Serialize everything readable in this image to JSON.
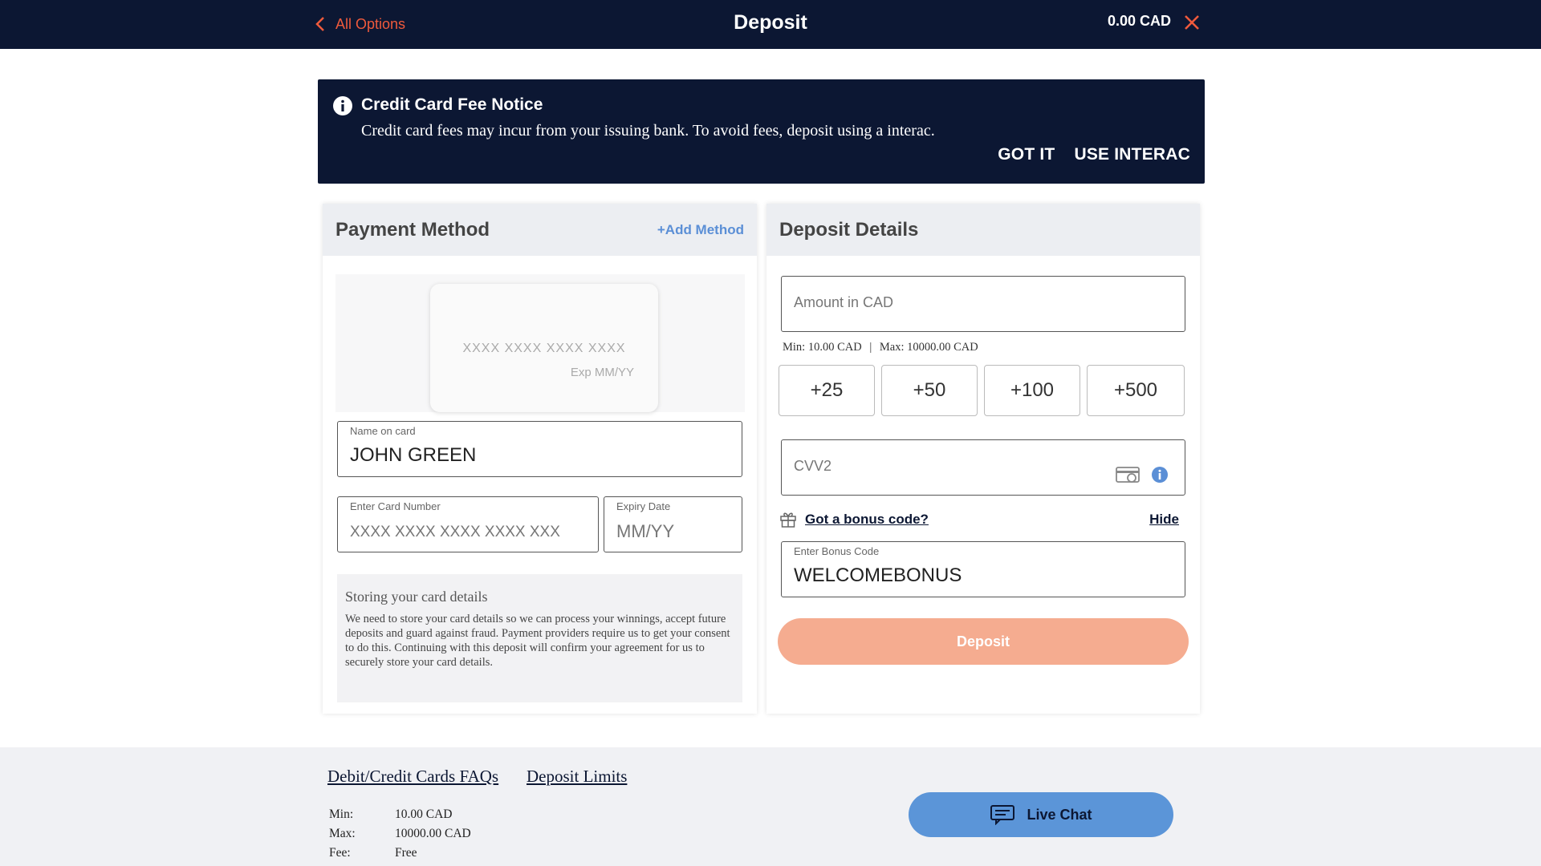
{
  "header": {
    "back_label": "All Options",
    "title": "Deposit",
    "balance": "0.00 CAD"
  },
  "notice": {
    "title": "Credit Card Fee Notice",
    "text": "Credit card fees may incur from your issuing bank. To avoid fees, deposit using a interac.",
    "got_it": "GOT IT",
    "use_interac": "USE INTERAC"
  },
  "payment_method": {
    "title": "Payment Method",
    "add_method": "+Add Method",
    "card_preview_number": "XXXX XXXX XXXX XXXX",
    "card_preview_exp": "Exp MM/YY",
    "name_label": "Name on card",
    "name_value": "JOHN GREEN",
    "card_number_label": "Enter Card Number",
    "card_number_placeholder": "XXXX XXXX XXXX XXXX XXX",
    "expiry_label": "Expiry Date",
    "expiry_placeholder": "MM/YY",
    "store_title": "Storing your card details",
    "store_text": "We need to store your card details so we can process your winnings, accept future deposits and guard against fraud. Payment providers require us to get your consent to do this. Continuing with this deposit will confirm your agreement for us to securely store your card details."
  },
  "deposit_details": {
    "title": "Deposit Details",
    "amount_placeholder": "Amount in CAD",
    "min_text": "Min: 10.00 CAD",
    "separator": "|",
    "max_text": "Max: 10000.00 CAD",
    "chips": [
      "+25",
      "+50",
      "+100",
      "+500"
    ],
    "cvv_placeholder": "CVV2",
    "bonus_link": "Got a bonus code?",
    "hide_link": "Hide",
    "bonus_label": "Enter Bonus Code",
    "bonus_value": "WELCOMEBONUS",
    "deposit_button": "Deposit"
  },
  "footer": {
    "faq_link": "Debit/Credit Cards FAQs",
    "limits_link": "Deposit Limits",
    "limits": [
      {
        "key": "Min:",
        "value": "10.00 CAD"
      },
      {
        "key": "Max:",
        "value": "10000.00 CAD"
      },
      {
        "key": "Fee:",
        "value": "Free"
      }
    ],
    "live_chat": "Live Chat"
  },
  "colors": {
    "navy": "#0c1733",
    "accent_orange": "#ef5a3c",
    "deposit_button": "#f5ac90",
    "link_blue": "#5b8fd6",
    "live_chat": "#5b95d8"
  },
  "icons": [
    "chevron-left-icon",
    "close-icon",
    "info-icon",
    "card-icon",
    "gift-icon",
    "chat-icon"
  ]
}
